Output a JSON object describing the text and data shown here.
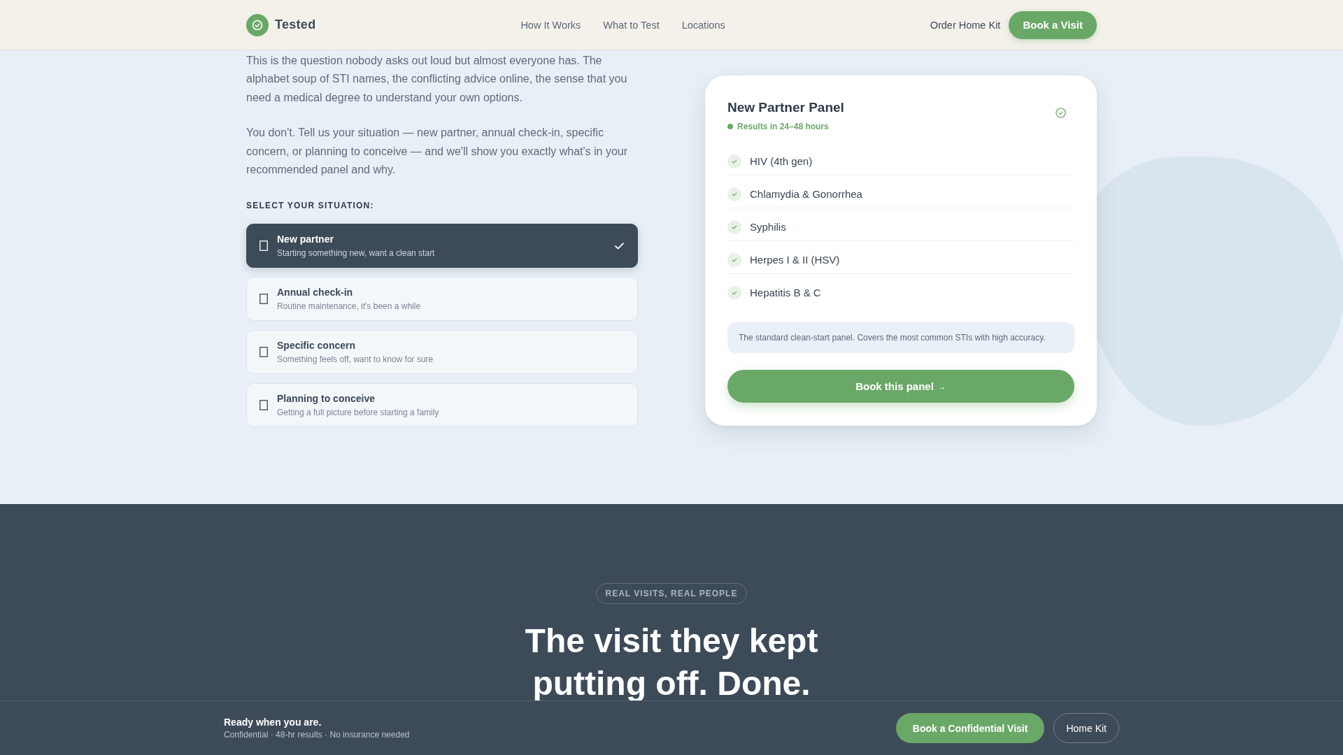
{
  "header": {
    "brand": "Tested",
    "nav": [
      "How It Works",
      "What to Test",
      "Locations"
    ],
    "secondary_link": "Order Home Kit",
    "cta": "Book a Visit"
  },
  "intro": {
    "paragraphs": [
      "This is the question nobody asks out loud but almost everyone has. The alphabet soup of STI names, the conflicting advice online, the sense that you need a medical degree to understand your own options.",
      "You don't. Tell us your situation — new partner, annual check-in, specific concern, or planning to conceive — and we'll show you exactly what's in your recommended panel and why."
    ]
  },
  "situation": {
    "label": "SELECT YOUR SITUATION:",
    "options": [
      {
        "title": "New partner",
        "subtitle": "Starting something new, want a clean start",
        "selected": true
      },
      {
        "title": "Annual check-in",
        "subtitle": "Routine maintenance, it's been a while",
        "selected": false
      },
      {
        "title": "Specific concern",
        "subtitle": "Something feels off, want to know for sure",
        "selected": false
      },
      {
        "title": "Planning to conceive",
        "subtitle": "Getting a full picture before starting a family",
        "selected": false
      }
    ]
  },
  "panel": {
    "title": "New Partner Panel",
    "turnaround": "Results in 24–48 hours",
    "tests": [
      "HIV (4th gen)",
      "Chlamydia & Gonorrhea",
      "Syphilis",
      "Herpes I & II (HSV)",
      "Hepatitis B & C"
    ],
    "note": "The standard clean-start panel. Covers the most common STIs with high accuracy.",
    "button": {
      "label": "Book this panel",
      "arrow": "→"
    }
  },
  "visits_section": {
    "badge": "REAL VISITS, REAL PEOPLE",
    "heading": "The visit they kept putting off. Done."
  },
  "sticky_bar": {
    "title": "Ready when you are.",
    "subtitle": "Confidential · 48-hr results · No insurance needed",
    "primary_button": "Book a Confidential Visit",
    "secondary_button": "Home Kit"
  }
}
